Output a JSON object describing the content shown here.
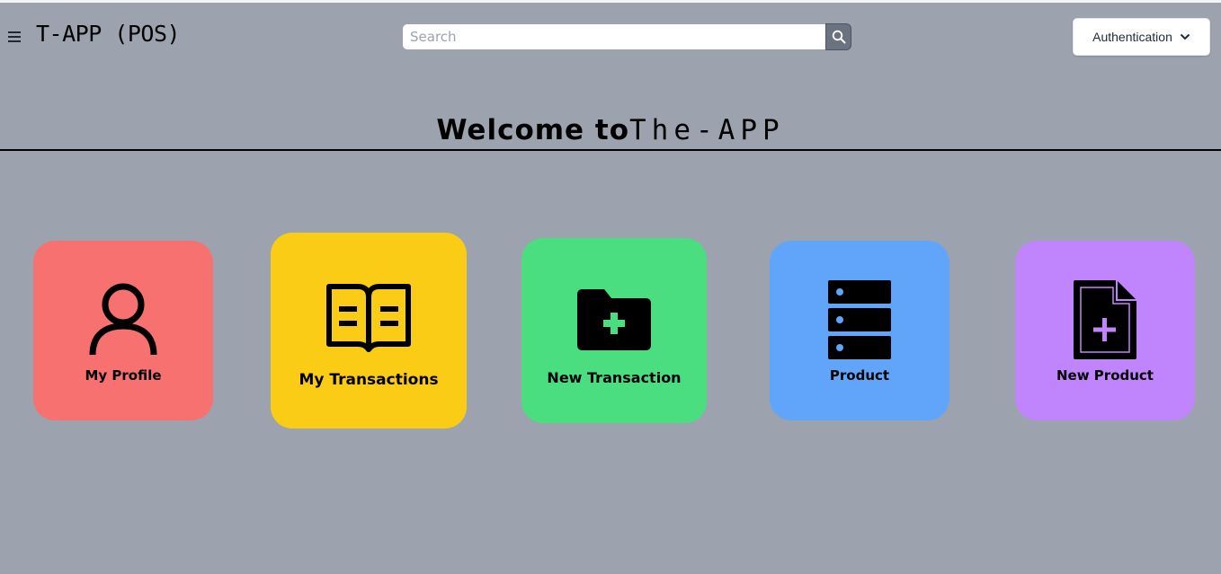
{
  "header": {
    "app_title": "T-APP (POS)",
    "search_placeholder": "Search",
    "search_value": "",
    "auth_label": "Authentication"
  },
  "welcome": {
    "part1": "Welcome to",
    "part2": "The-APP"
  },
  "cards": [
    {
      "label": "My Profile",
      "color": "#f87171",
      "icon": "user-icon"
    },
    {
      "label": "My Transactions",
      "color": "#facc15",
      "icon": "book-open-icon"
    },
    {
      "label": "New Transaction",
      "color": "#4ade80",
      "icon": "folder-plus-icon"
    },
    {
      "label": "Product",
      "color": "#60a5fa",
      "icon": "server-icon"
    },
    {
      "label": "New Product",
      "color": "#c084fc",
      "icon": "file-plus-icon"
    }
  ]
}
